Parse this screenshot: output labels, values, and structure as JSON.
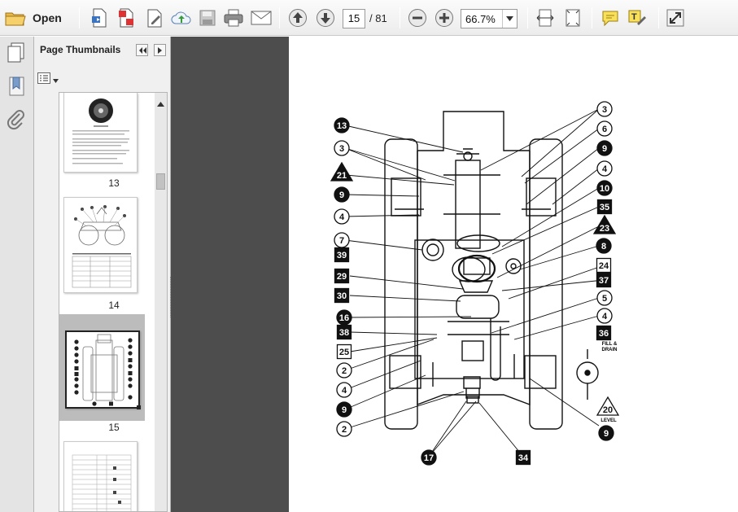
{
  "toolbar": {
    "open_label": "Open",
    "current_page": "15",
    "total_pages": "/ 81",
    "zoom_level": "66.7%"
  },
  "panel": {
    "title": "Page Thumbnails",
    "thumbnails": [
      {
        "label": "13"
      },
      {
        "label": "14"
      },
      {
        "label": "15"
      }
    ]
  },
  "diagram": {
    "callouts": [
      {
        "text": "13",
        "style": "circle-dark"
      },
      {
        "text": "3",
        "style": "circle-light"
      },
      {
        "text": "3",
        "style": "circle-light"
      },
      {
        "text": "6",
        "style": "circle-light"
      },
      {
        "text": "9",
        "style": "circle-dark"
      },
      {
        "text": "21",
        "style": "triangle-dark"
      },
      {
        "text": "4",
        "style": "circle-light"
      },
      {
        "text": "9",
        "style": "circle-dark"
      },
      {
        "text": "10",
        "style": "circle-dark"
      },
      {
        "text": "4",
        "style": "circle-light"
      },
      {
        "text": "35",
        "style": "square-dark"
      },
      {
        "text": "23",
        "style": "triangle-dark"
      },
      {
        "text": "7",
        "style": "circle-light"
      },
      {
        "text": "39",
        "style": "square-dark"
      },
      {
        "text": "8",
        "style": "circle-dark"
      },
      {
        "text": "24",
        "style": "square-light"
      },
      {
        "text": "29",
        "style": "square-dark"
      },
      {
        "text": "37",
        "style": "square-dark"
      },
      {
        "text": "30",
        "style": "square-dark"
      },
      {
        "text": "5",
        "style": "circle-light"
      },
      {
        "text": "16",
        "style": "circle-dark"
      },
      {
        "text": "4",
        "style": "circle-light"
      },
      {
        "text": "38",
        "style": "square-dark"
      },
      {
        "text": "36",
        "style": "square-dark"
      },
      {
        "text": "25",
        "style": "square-light"
      },
      {
        "text": "2",
        "style": "circle-light"
      },
      {
        "text": "4",
        "style": "circle-light"
      },
      {
        "text": "9",
        "style": "circle-dark"
      },
      {
        "text": "20",
        "style": "triangle-light"
      },
      {
        "text": "2",
        "style": "circle-light"
      },
      {
        "text": "9",
        "style": "circle-dark"
      },
      {
        "text": "17",
        "style": "circle-dark"
      },
      {
        "text": "34",
        "style": "square-dark"
      }
    ],
    "notes": {
      "fill_drain_1": "FILL &",
      "fill_drain_2": "DRAIN",
      "level": "LEVEL"
    }
  },
  "colors": {
    "splitter": "#4d4d4d",
    "panel_bg": "#f0f0f0",
    "toolbar_bg": "#ececec"
  }
}
